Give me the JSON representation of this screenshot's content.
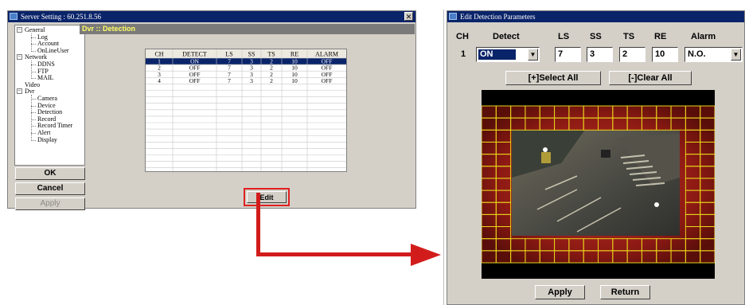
{
  "left_window": {
    "title": "Server Setting : 60.251.8.56",
    "close_glyph": "✕",
    "tree": [
      {
        "label": "General",
        "level": 0,
        "expander": "−"
      },
      {
        "label": "Log",
        "level": 1
      },
      {
        "label": "Account",
        "level": 1
      },
      {
        "label": "OnLineUser",
        "level": 1
      },
      {
        "label": "Network",
        "level": 0,
        "expander": "−"
      },
      {
        "label": "DDNS",
        "level": 1
      },
      {
        "label": "FTP",
        "level": 1
      },
      {
        "label": "MAIL",
        "level": 1
      },
      {
        "label": "Video",
        "level": 0
      },
      {
        "label": "Dvr",
        "level": 0,
        "expander": "−"
      },
      {
        "label": "Camera",
        "level": 1
      },
      {
        "label": "Device",
        "level": 1
      },
      {
        "label": "Detection",
        "level": 1
      },
      {
        "label": "Record",
        "level": 1
      },
      {
        "label": "Record Timer",
        "level": 1
      },
      {
        "label": "Alert",
        "level": 1
      },
      {
        "label": "Display",
        "level": 1
      }
    ],
    "buttons": {
      "ok": "OK",
      "cancel": "Cancel",
      "apply": "Apply"
    },
    "panel_title": "Dvr :: Detection",
    "table": {
      "columns": [
        "CH",
        "DETECT",
        "LS",
        "SS",
        "TS",
        "RE",
        "ALARM"
      ],
      "rows": [
        [
          "1",
          "ON",
          "7",
          "3",
          "2",
          "10",
          "OFF"
        ],
        [
          "2",
          "OFF",
          "7",
          "3",
          "2",
          "10",
          "OFF"
        ],
        [
          "3",
          "OFF",
          "7",
          "3",
          "2",
          "10",
          "OFF"
        ],
        [
          "4",
          "OFF",
          "7",
          "3",
          "2",
          "10",
          "OFF"
        ]
      ],
      "selected_row": 0
    },
    "edit_button": "Edit"
  },
  "right_window": {
    "title": "Edit Detection Parameters",
    "headers": {
      "ch": "CH",
      "detect": "Detect",
      "ls": "LS",
      "ss": "SS",
      "ts": "TS",
      "re": "RE",
      "alarm": "Alarm"
    },
    "values": {
      "ch": "1",
      "detect": "ON",
      "ls": "7",
      "ss": "3",
      "ts": "2",
      "re": "10",
      "alarm": "N.O."
    },
    "select_all": "[+]Select All",
    "clear_all": "[-]Clear All",
    "apply": "Apply",
    "return": "Return",
    "dropdown_glyph": "▼"
  },
  "colors": {
    "accent": "#d21c1c",
    "titlebar": "#0a246a",
    "panel_text": "#ffff66",
    "grid_line": "#e8d21a"
  }
}
